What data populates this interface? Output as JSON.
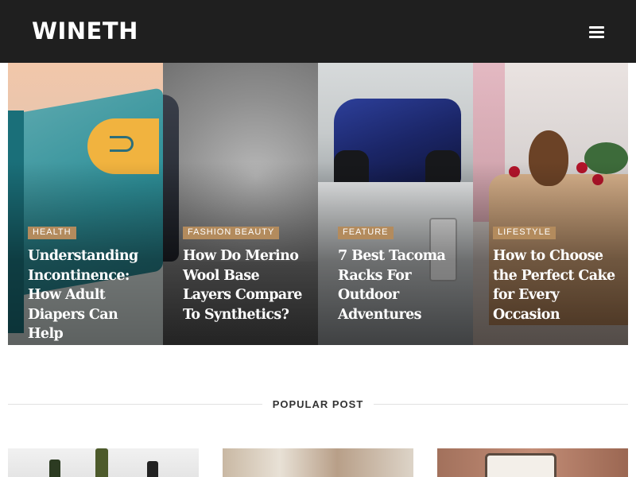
{
  "header": {
    "logo": "WINETH",
    "menu_icon": "hamburger-icon"
  },
  "featured": [
    {
      "category": "HEALTH",
      "title": "Understanding Incontinence: How Adult Diapers Can Help"
    },
    {
      "category": "FASHION BEAUTY",
      "title": "How Do Merino Wool Base Layers Compare To Synthetics?"
    },
    {
      "category": "FEATURE",
      "title": "7 Best Tacoma Racks For Outdoor Adventures"
    },
    {
      "category": "LIFESTYLE",
      "title": "How to Choose the Perfect Cake for Every Occasion"
    }
  ],
  "popular": {
    "heading": "POPULAR POST"
  },
  "colors": {
    "header_bg": "#1f1f1f",
    "tag_bg": "#b38b5d"
  }
}
